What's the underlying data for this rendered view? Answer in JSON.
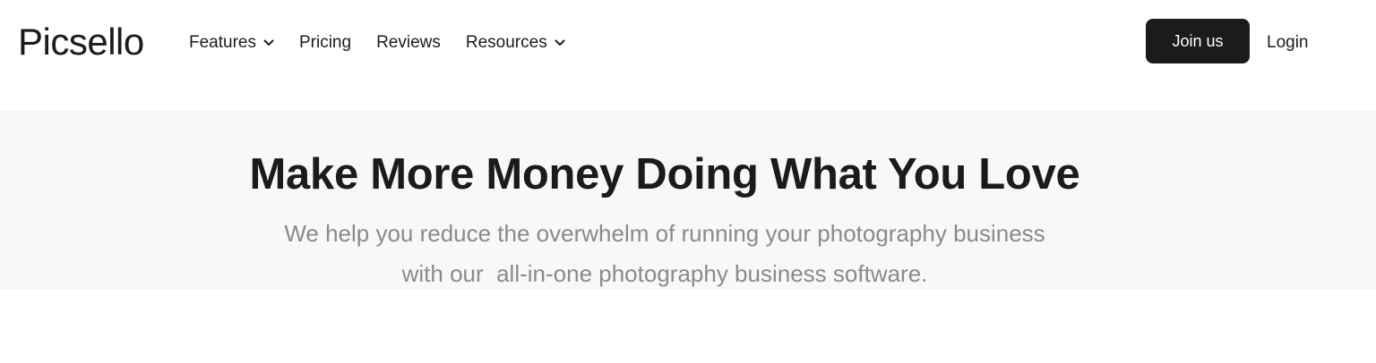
{
  "header": {
    "logo": "Picsello",
    "nav": {
      "features": "Features",
      "pricing": "Pricing",
      "reviews": "Reviews",
      "resources": "Resources"
    },
    "join_label": "Join us",
    "login_label": "Login"
  },
  "hero": {
    "title": "Make More Money Doing What You Love",
    "subtitle_line1": "We help you reduce the overwhelm of running your photography business",
    "subtitle_line2": "with our  all-in-one photography business software."
  },
  "icons": {
    "dropdown": "chevron-down-icon"
  },
  "colors": {
    "text": "#1c1b1c",
    "button_bg": "#1c1b1c",
    "button_text": "#ffffff",
    "hero_bg": "#f7f8fa",
    "subtitle": "#8a8a8a"
  }
}
